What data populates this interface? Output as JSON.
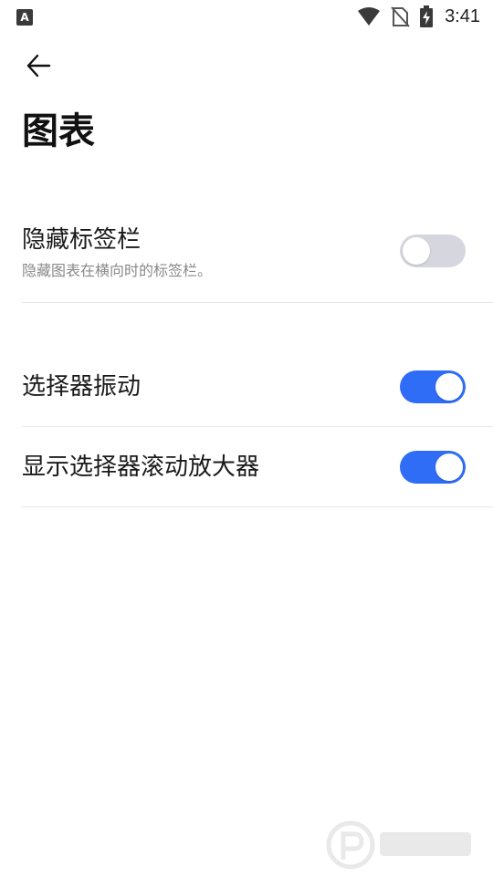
{
  "status_bar": {
    "app_icon_label": "A",
    "time": "3:41",
    "icons": [
      "wifi-icon",
      "no-sim-icon",
      "battery-charging-icon"
    ]
  },
  "header": {
    "back_icon": "arrow-left-icon",
    "title": "图表"
  },
  "settings": [
    {
      "title": "隐藏标签栏",
      "description": "隐藏图表在横向时的标签栏。",
      "enabled": false
    },
    {
      "title": "选择器振动",
      "enabled": true
    },
    {
      "title": "显示选择器滚动放大器",
      "enabled": true
    }
  ],
  "colors": {
    "toggle_on": "#2f6df6",
    "toggle_off": "#d6d7de",
    "text_primary": "#1a1a1a",
    "text_secondary": "#8a8a8a",
    "divider": "#e6e6e6"
  }
}
